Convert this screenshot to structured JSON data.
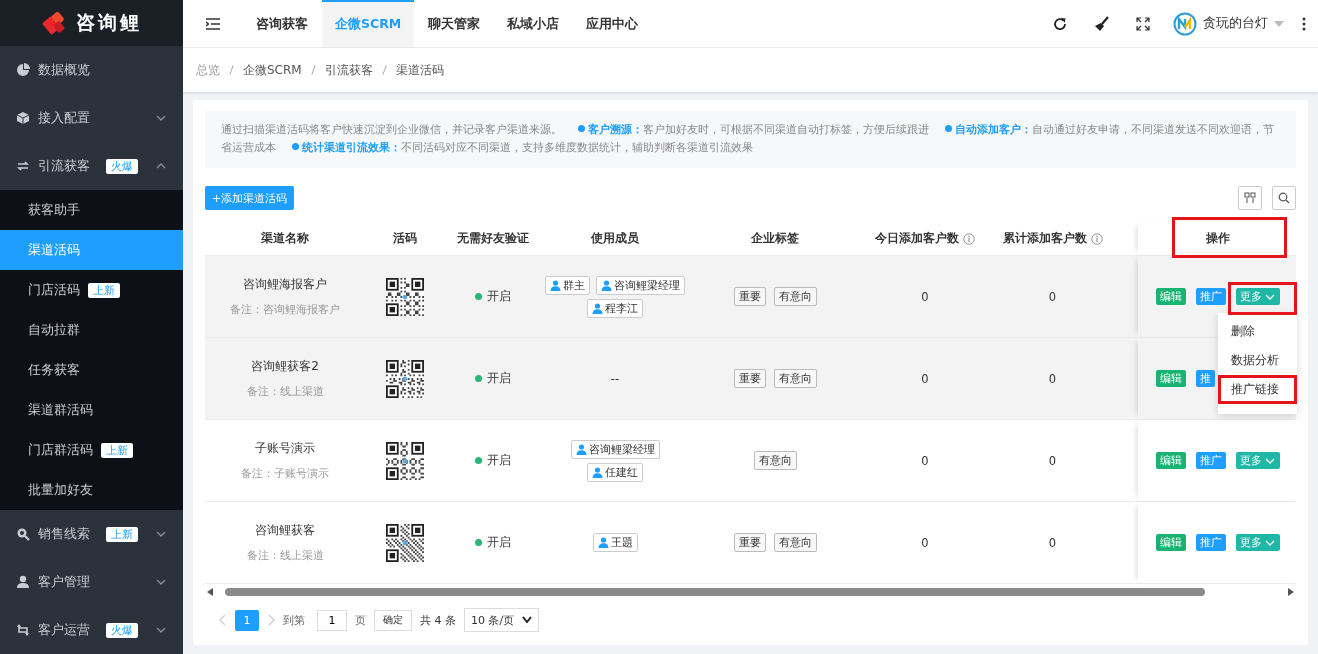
{
  "sidebar": {
    "logo": "咨询鲤",
    "items": [
      {
        "label": "数据概览",
        "kind": "link"
      },
      {
        "label": "接入配置",
        "kind": "group",
        "expanded": false
      },
      {
        "label": "引流获客",
        "kind": "group",
        "badge": "火爆",
        "expanded": true,
        "children": [
          {
            "label": "获客助手",
            "selected": false
          },
          {
            "label": "渠道活码",
            "selected": true
          },
          {
            "label": "门店活码",
            "badge": "上新",
            "selected": false
          },
          {
            "label": "自动拉群",
            "selected": false
          },
          {
            "label": "任务获客",
            "selected": false
          },
          {
            "label": "渠道群活码",
            "selected": false
          },
          {
            "label": "门店群活码",
            "badge": "上新",
            "selected": false
          },
          {
            "label": "批量加好友",
            "selected": false
          }
        ]
      },
      {
        "label": "销售线索",
        "kind": "group",
        "badge": "上新",
        "expanded": false
      },
      {
        "label": "客户管理",
        "kind": "group",
        "expanded": false
      },
      {
        "label": "客户运营",
        "kind": "group",
        "badge": "火爆",
        "expanded": false
      }
    ]
  },
  "topbar": {
    "tabs": [
      {
        "label": "咨询获客",
        "selected": false
      },
      {
        "label": "企微SCRM",
        "selected": true
      },
      {
        "label": "聊天管家",
        "selected": false
      },
      {
        "label": "私域小店",
        "selected": false
      },
      {
        "label": "应用中心",
        "selected": false
      }
    ],
    "user": "贪玩的台灯"
  },
  "breadcrumb": [
    "总览",
    "企微SCRM",
    "引流获客",
    "渠道活码"
  ],
  "notice": [
    {
      "text": "通过扫描渠道活码将客户快速沉淀到企业微信，并记录客户渠道来源。"
    },
    {
      "title": "客户溯源：",
      "text": "客户加好友时，可根据不同渠道自动打标签，方便后续跟进"
    },
    {
      "title": "自动添加客户：",
      "text": "自动通过好友申请，不同渠道发送不同欢迎语，节省运营成本"
    },
    {
      "title": "统计渠道引流效果：",
      "text": "不同活码对应不同渠道，支持多维度数据统计，辅助判断各渠道引流效果"
    }
  ],
  "add_button": "+添加渠道活码",
  "table": {
    "columns": [
      {
        "label": "渠道名称"
      },
      {
        "label": "活码"
      },
      {
        "label": "无需好友验证"
      },
      {
        "label": "使用成员"
      },
      {
        "label": "企业标签"
      },
      {
        "label": "今日添加客户数",
        "info": true
      },
      {
        "label": "累计添加客户数",
        "info": true
      },
      {
        "label": "操作",
        "annotated": true
      }
    ],
    "rows": [
      {
        "name": "咨询鲤海报客户",
        "note": "备注：咨询鲤海报客户",
        "hover": true,
        "verify": {
          "on": true,
          "label": "开启"
        },
        "members": [
          "群主",
          "咨询鲤梁经理",
          "程李江"
        ],
        "tags": [
          "重要",
          "有意向"
        ],
        "today": "0",
        "total": "0",
        "actions": {
          "edit": "编辑",
          "promote": "推广",
          "more": "更多",
          "more_annotated": true,
          "menu": [
            {
              "label": "删除",
              "annotated": false
            },
            {
              "label": "数据分析",
              "annotated": false
            },
            {
              "label": "推广链接",
              "annotated": true
            }
          ]
        }
      },
      {
        "name": "咨询鲤获客2",
        "note": "备注：线上渠道",
        "hover": true,
        "verify": {
          "on": true,
          "label": "开启"
        },
        "members_text": "--",
        "tags": [
          "重要",
          "有意向"
        ],
        "today": "0",
        "total": "0",
        "actions": {
          "edit": "编辑",
          "promote": "推"
        }
      },
      {
        "name": "子账号演示",
        "note": "备注：子账号演示",
        "hover": false,
        "verify": {
          "on": true,
          "label": "开启"
        },
        "members": [
          "咨询鲤梁经理",
          "任建红"
        ],
        "tags": [
          "有意向"
        ],
        "today": "0",
        "total": "0",
        "actions": {
          "edit": "编辑",
          "promote": "推广",
          "more": "更多",
          "more_annotated": false
        }
      },
      {
        "name": "咨询鲤获客",
        "note": "备注：线上渠道",
        "hover": false,
        "verify": {
          "on": true,
          "label": "开启"
        },
        "members": [
          "王題"
        ],
        "tags": [
          "重要",
          "有意向"
        ],
        "today": "0",
        "total": "0",
        "actions": {
          "edit": "编辑",
          "promote": "推广",
          "more": "更多",
          "more_annotated": false
        }
      }
    ]
  },
  "pagination": {
    "pages": [
      {
        "label": "1",
        "selected": true
      }
    ],
    "goto_label": "到第",
    "goto_value": "1",
    "page_unit": "页",
    "confirm": "确定",
    "total": "共 4 条",
    "page_size": "10 条/页"
  }
}
